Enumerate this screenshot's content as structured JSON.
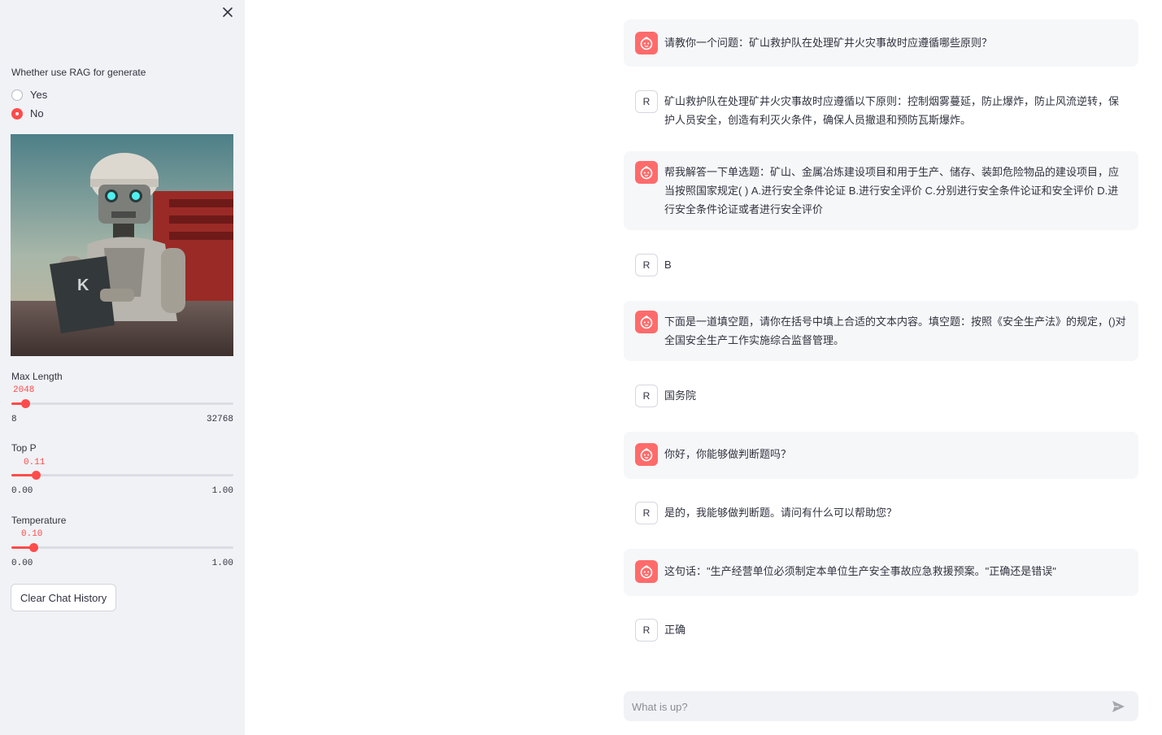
{
  "sidebar": {
    "rag_label": "Whether use RAG for generate",
    "rag_options": [
      {
        "label": "Yes",
        "selected": false
      },
      {
        "label": "No",
        "selected": true
      }
    ],
    "image_icon": "robot-illustration",
    "sliders": {
      "max_length": {
        "label": "Max Length",
        "value": "2048",
        "min": "8",
        "max": "32768",
        "fraction": 0.062
      },
      "top_p": {
        "label": "Top P",
        "value": "0.11",
        "min": "0.00",
        "max": "1.00",
        "fraction": 0.11
      },
      "temperature": {
        "label": "Temperature",
        "value": "0.10",
        "min": "0.00",
        "max": "1.00",
        "fraction": 0.1
      }
    },
    "clear_button": "Clear Chat History"
  },
  "chat": {
    "messages": [
      {
        "role": "user",
        "text": "请教你一个问题：矿山救护队在处理矿井火灾事故时应遵循哪些原则？"
      },
      {
        "role": "assistant",
        "avatar": "R",
        "text": "矿山救护队在处理矿井火灾事故时应遵循以下原则：控制烟雾蔓延，防止爆炸，防止风流逆转，保护人员安全，创造有利灭火条件，确保人员撤退和预防瓦斯爆炸。"
      },
      {
        "role": "user",
        "text": "帮我解答一下单选题：矿山、金属冶炼建设项目和用于生产、储存、装卸危险物品的建设项目，应当按照国家规定( ) A.进行安全条件论证 B.进行安全评价 C.分别进行安全条件论证和安全评价 D.进行安全条件论证或者进行安全评价"
      },
      {
        "role": "assistant",
        "avatar": "R",
        "text": "B"
      },
      {
        "role": "user",
        "text": "下面是一道填空题，请你在括号中填上合适的文本内容。填空题：按照《安全生产法》的规定，()对全国安全生产工作实施综合监督管理。"
      },
      {
        "role": "assistant",
        "avatar": "R",
        "text": "国务院"
      },
      {
        "role": "user",
        "text": "你好，你能够做判断题吗？"
      },
      {
        "role": "assistant",
        "avatar": "R",
        "text": "是的，我能够做判断题。请问有什么可以帮助您？"
      },
      {
        "role": "user",
        "text": "这句话：\"生产经营单位必须制定本单位生产安全事故应急救援预案。\"正确还是错误\""
      },
      {
        "role": "assistant",
        "avatar": "R",
        "text": "正确"
      }
    ],
    "input_placeholder": "What is up?"
  },
  "colors": {
    "accent": "#ff4b4b",
    "user_avatar": "#ff6b6b",
    "sidebar_bg": "#f0f2f6",
    "user_msg_bg": "#f6f7f9"
  },
  "icons": {
    "close": "close-icon",
    "user_avatar": "bot-face-icon",
    "send": "send-icon"
  }
}
